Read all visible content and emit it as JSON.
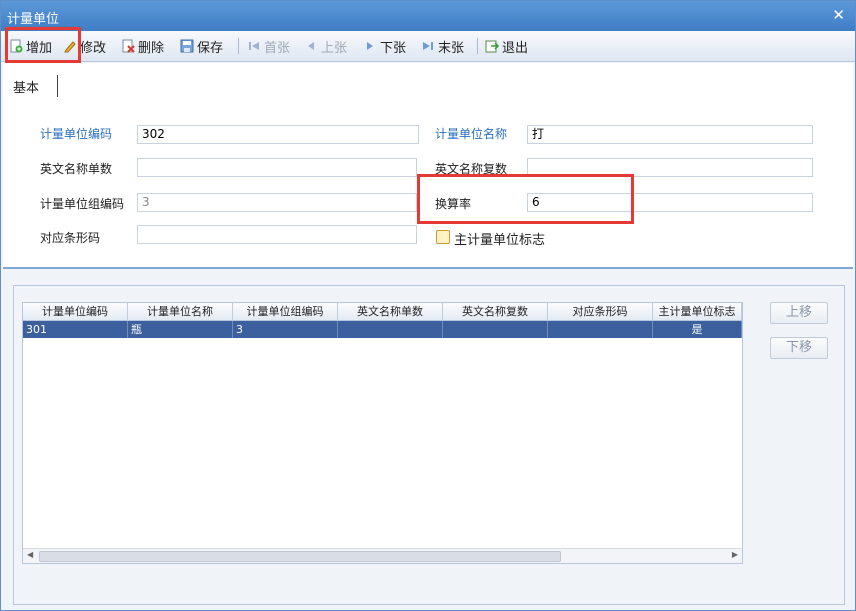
{
  "window": {
    "title": "计量单位",
    "close_glyph": "✕"
  },
  "toolbar": {
    "add": "增加",
    "edit": "修改",
    "delete": "删除",
    "save": "保存",
    "first": "首张",
    "prev": "上张",
    "next": "下张",
    "last": "末张",
    "exit": "退出"
  },
  "tabs": [
    {
      "label": "基本"
    }
  ],
  "form": {
    "unit_code_label": "计量单位编码",
    "unit_code_value": "302",
    "unit_name_label": "计量单位名称",
    "unit_name_value": "打",
    "en_singular_label": "英文名称单数",
    "en_singular_value": "",
    "en_plural_label": "英文名称复数",
    "en_plural_value": "",
    "group_code_label": "计量单位组编码",
    "group_code_value": "3",
    "rate_label": "换算率",
    "rate_value": "6",
    "barcode_label": "对应条形码",
    "barcode_value": "",
    "main_unit_label": "主计量单位标志"
  },
  "grid": {
    "columns": [
      "计量单位编码",
      "计量单位名称",
      "计量单位组编码",
      "英文名称单数",
      "英文名称复数",
      "对应条形码",
      "主计量单位标志"
    ],
    "rows": [
      [
        "301",
        "瓶",
        "3",
        "",
        "",
        "",
        "是"
      ]
    ]
  },
  "side": {
    "up": "上移",
    "down": "下移"
  },
  "colors": {
    "titlebar": "#4a89cf",
    "highlight": "#e53935",
    "selected_row": "#3c5f9d",
    "label_blue": "#2a6fc0"
  }
}
